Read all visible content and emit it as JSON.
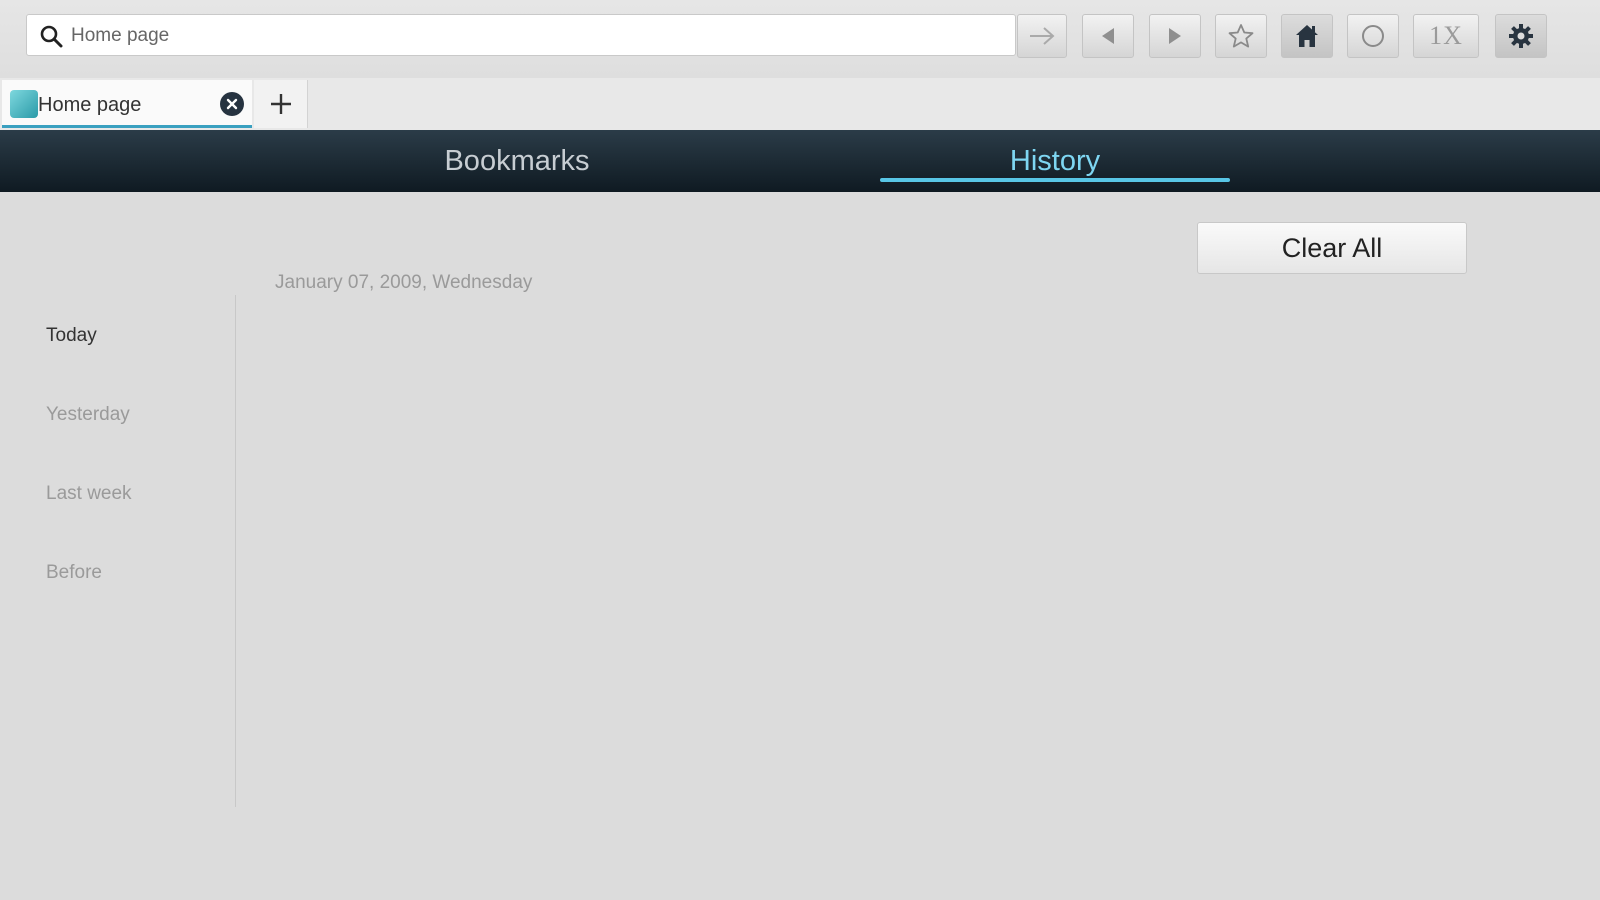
{
  "toolbar": {
    "url_placeholder": "Home page",
    "zoom_label": "1X",
    "icons": [
      "search-icon",
      "go-arrow-icon",
      "back-icon",
      "forward-icon",
      "star-icon",
      "home-icon",
      "circle-icon",
      "gear-icon"
    ]
  },
  "tabs": [
    {
      "title": "Home page",
      "active": true
    }
  ],
  "nav": {
    "items": [
      "Bookmarks",
      "History"
    ],
    "active": "History",
    "accent": "#58c6e6"
  },
  "history": {
    "clear_label": "Clear All",
    "date_heading": "January 07, 2009, Wednesday",
    "periods": [
      "Today",
      "Yesterday",
      "Last week",
      "Before"
    ],
    "active_period": "Today"
  }
}
